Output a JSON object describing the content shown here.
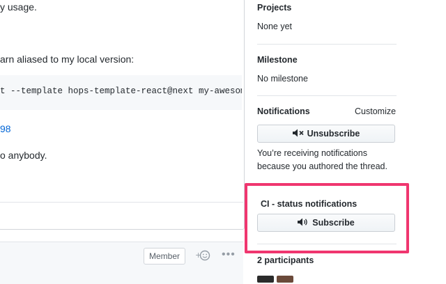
{
  "comment": {
    "line1": "y usage.",
    "line2": "arn aliased to my local version:",
    "code": "t --template hops-template-react@next my-awesom",
    "link": "98",
    "line3": "o anybody."
  },
  "comment_footer": {
    "member_badge": "Member",
    "reaction_icon": "add-reaction-icon",
    "more_icon": "kebab-horizontal-icon"
  },
  "sidebar": {
    "projects": {
      "heading": "Projects",
      "value": "None yet"
    },
    "milestone": {
      "heading": "Milestone",
      "value": "No milestone"
    },
    "notifications": {
      "heading": "Notifications",
      "customize_label": "Customize",
      "button_icon": "mute-icon",
      "button_label": "Unsubscribe",
      "reason_line1": "You’re receiving notifications",
      "reason_line2": "because you authored the thread."
    },
    "ci_notifications": {
      "heading": "CI - status notifications",
      "button_icon": "unmute-icon",
      "button_label": "Subscribe",
      "highlight_color": "#f0366f"
    },
    "participants": {
      "heading": "2 participants"
    }
  }
}
